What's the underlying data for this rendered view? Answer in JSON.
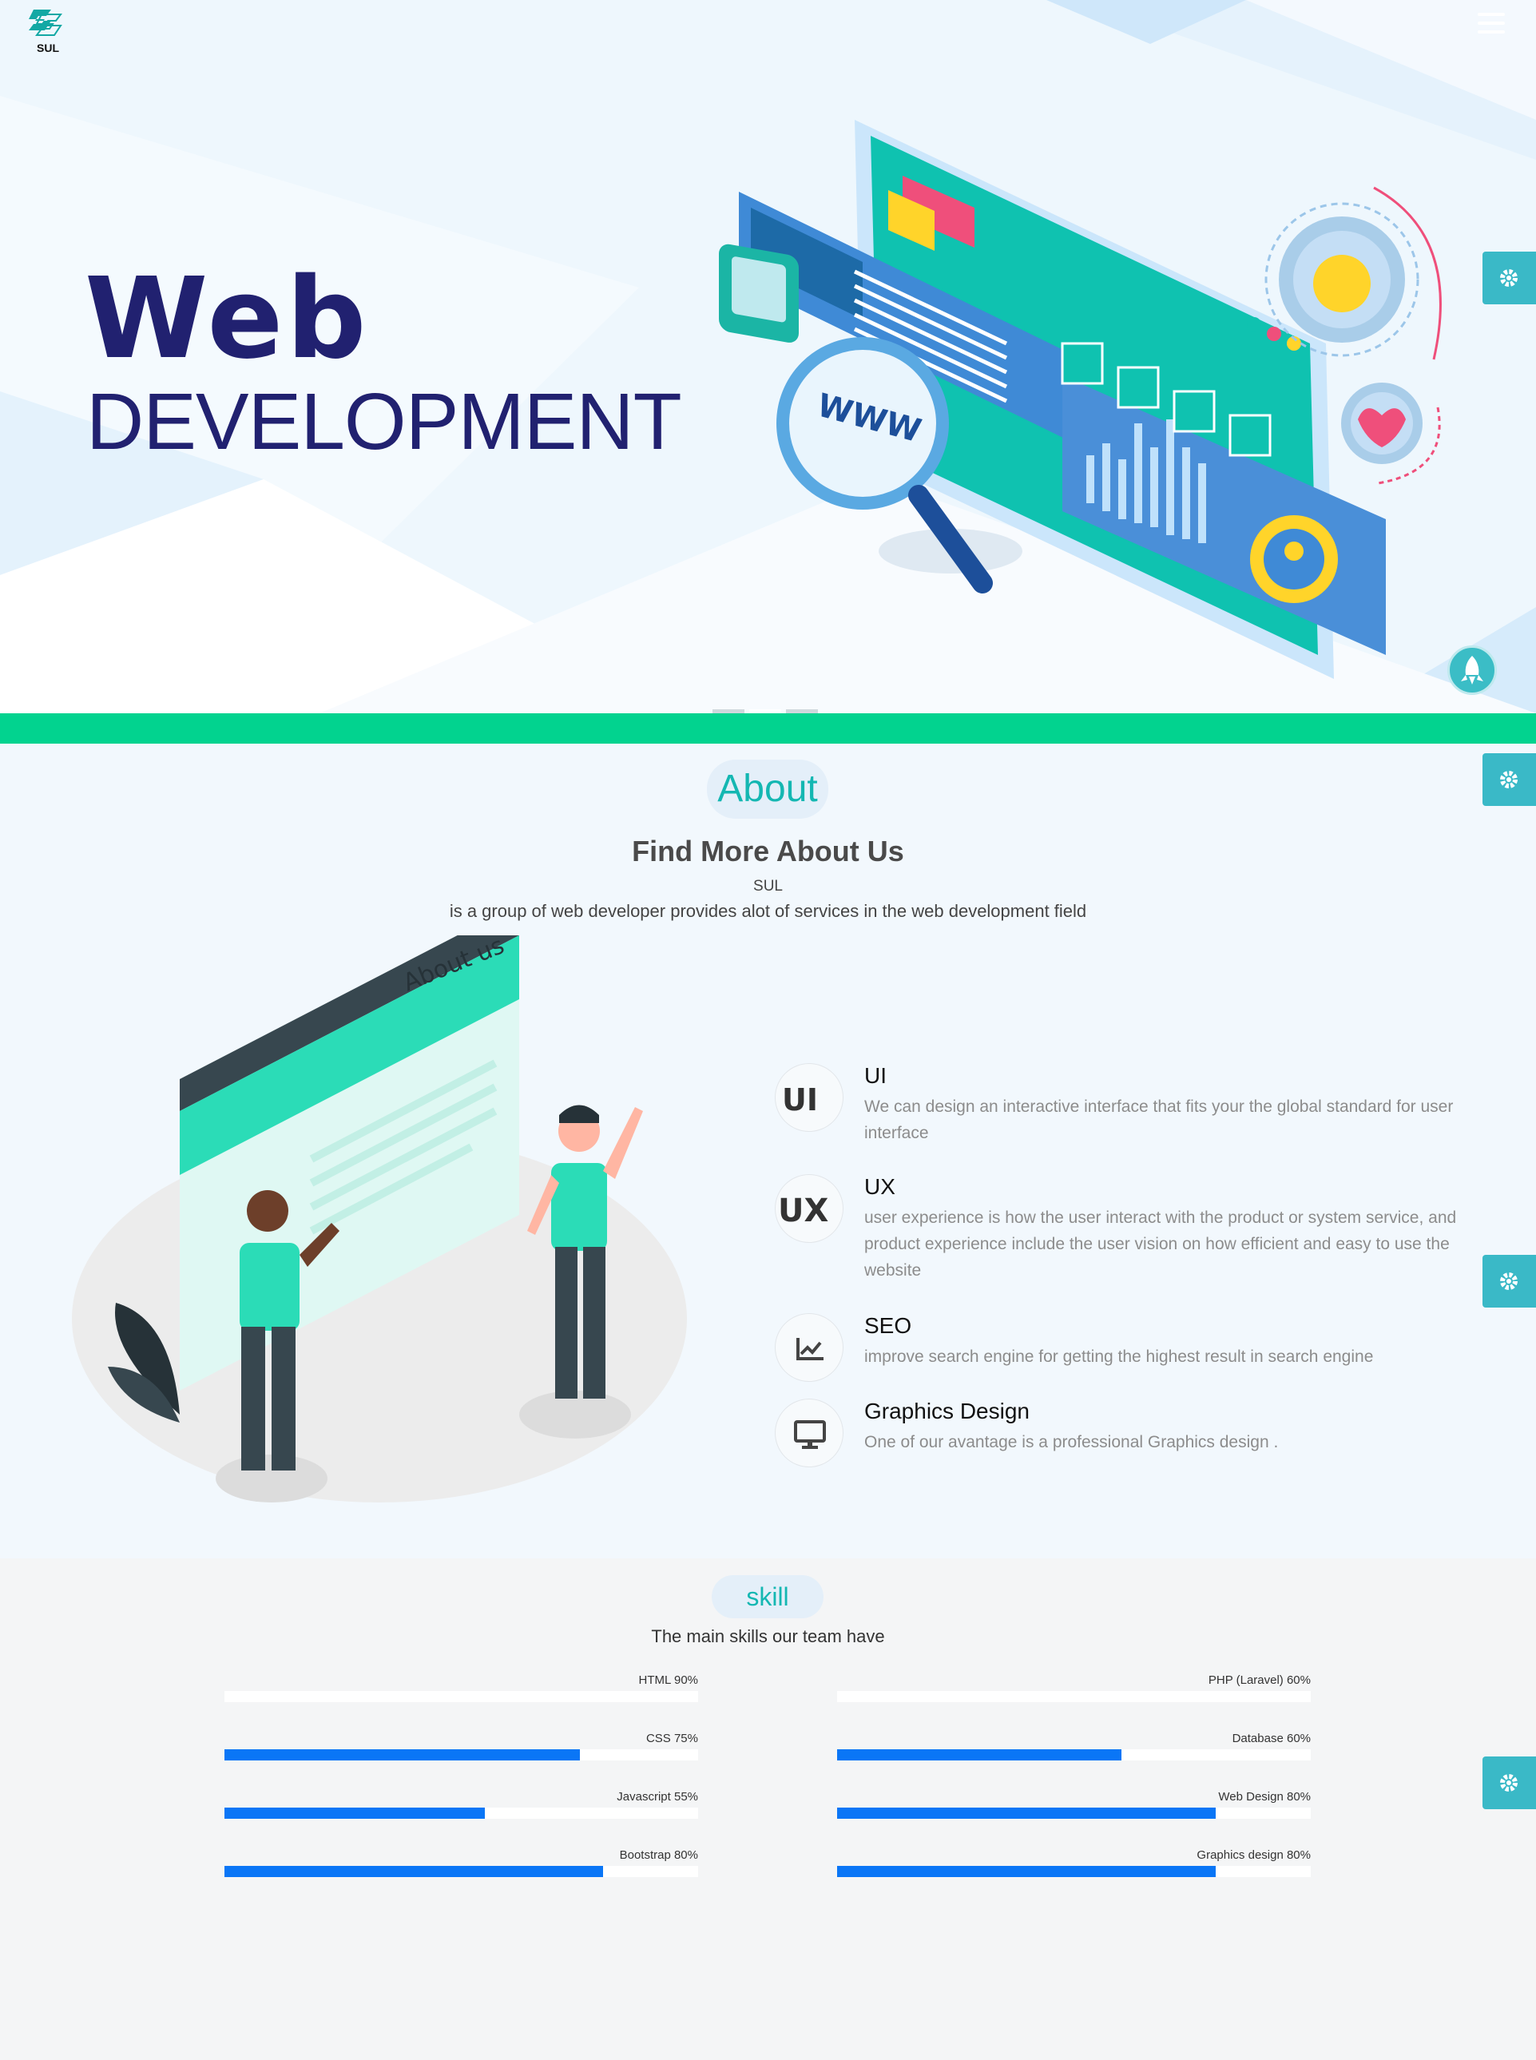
{
  "brand": {
    "name": "SUL"
  },
  "hero": {
    "title": "Web",
    "subtitle": "DEVELOPMENT",
    "carousel_slides": 3,
    "active_slide": 2
  },
  "about": {
    "section_label": "About",
    "heading": "Find More About Us",
    "company": "SUL",
    "description": "is a group of web developer provides alot of services in the web development field",
    "illustration_caption": "About us",
    "services": [
      {
        "icon": "ui-icon",
        "icon_text": "UI",
        "title": "UI",
        "text": "We can design an interactive interface that fits your the global standard for user interface"
      },
      {
        "icon": "ux-icon",
        "icon_text": "UX",
        "title": "UX",
        "text": "user experience is how the user interact with the product or system service, and product experience include the user vision on how efficient and easy to use the website"
      },
      {
        "icon": "chart-icon",
        "title": "SEO",
        "text": "improve search engine for getting the highest result in search engine"
      },
      {
        "icon": "monitor-icon",
        "title": "Graphics Design",
        "text": "One of our avantage is a professional Graphics design ."
      }
    ]
  },
  "skill": {
    "section_label": "skill",
    "subtitle": "The main skills our team have",
    "left": [
      {
        "label": "HTML 90%",
        "value": 0
      },
      {
        "label": "CSS 75%",
        "value": 75
      },
      {
        "label": "Javascript 55%",
        "value": 55
      },
      {
        "label": "Bootstrap 80%",
        "value": 80
      }
    ],
    "right": [
      {
        "label": "PHP (Laravel) 60%",
        "value": 0
      },
      {
        "label": "Database 60%",
        "value": 60
      },
      {
        "label": "Web Design 80%",
        "value": 80
      },
      {
        "label": "Graphics design 80%",
        "value": 80
      }
    ]
  },
  "colors": {
    "accent": "#14b7b2",
    "navy": "#212170",
    "band": "#02d38f",
    "bar": "#0a76f6",
    "tab": "#3ab9c7"
  }
}
